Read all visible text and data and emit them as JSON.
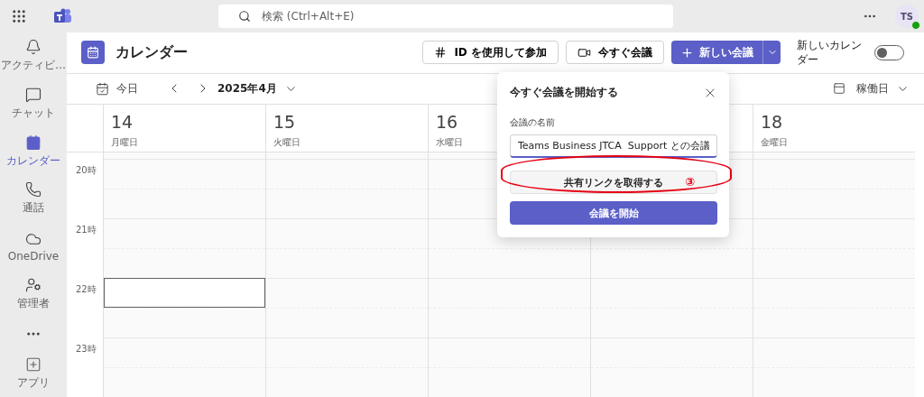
{
  "app_bar": {
    "search": {
      "placeholder": "検索 (Ctrl+Alt+E)"
    },
    "avatar": {
      "initials": "TS"
    }
  },
  "sidebar": {
    "items": [
      {
        "label": "アクティビ…",
        "selected": false
      },
      {
        "label": "チャット",
        "selected": false
      },
      {
        "label": "カレンダー",
        "selected": true
      },
      {
        "label": "通話",
        "selected": false
      },
      {
        "label": "OneDrive",
        "selected": false
      },
      {
        "label": "管理者",
        "selected": false
      }
    ],
    "apps": {
      "label": "アプリ"
    }
  },
  "header": {
    "title": "カレンダー",
    "join_button": "ID を使用して参加",
    "meet_now_button": "今すぐ会議",
    "new_meeting_button": "新しい会議",
    "new_calendar": {
      "label": "新しいカレンダー",
      "on": false
    }
  },
  "nav": {
    "today": "今日",
    "month": "2025年4月",
    "view": "稼働日"
  },
  "hours": [
    "20時",
    "21時",
    "22時",
    "23時"
  ],
  "days": [
    {
      "date": "14",
      "weekday": "月曜日",
      "slots": [
        {
          "selected": false
        },
        {
          "selected": false
        },
        {
          "selected": false
        },
        {
          "selected": false
        },
        {
          "selected": true
        },
        {
          "selected": false
        },
        {
          "selected": false
        },
        {
          "selected": false
        }
      ]
    },
    {
      "date": "15",
      "weekday": "火曜日",
      "slots": [
        {
          "selected": false
        },
        {
          "selected": false
        },
        {
          "selected": false
        },
        {
          "selected": false
        },
        {
          "selected": false
        },
        {
          "selected": false
        },
        {
          "selected": false
        },
        {
          "selected": false
        }
      ]
    },
    {
      "date": "16",
      "weekday": "水曜日",
      "slots": [
        {
          "selected": false
        },
        {
          "selected": false
        },
        {
          "selected": false
        },
        {
          "selected": false
        },
        {
          "selected": false
        },
        {
          "selected": false
        },
        {
          "selected": false
        },
        {
          "selected": false
        }
      ]
    },
    {
      "slots": [
        {
          "selected": false
        },
        {
          "selected": false
        },
        {
          "selected": false
        },
        {
          "selected": false
        },
        {
          "selected": false
        },
        {
          "selected": false
        },
        {
          "selected": false
        },
        {
          "selected": false
        }
      ]
    },
    {
      "date": "18",
      "weekday": "金曜日",
      "slots": [
        {
          "selected": false
        },
        {
          "selected": false
        },
        {
          "selected": false
        },
        {
          "selected": false
        },
        {
          "selected": false
        },
        {
          "selected": false
        },
        {
          "selected": false
        },
        {
          "selected": false
        }
      ]
    }
  ],
  "meet_now_popup": {
    "title": "今すぐ会議を開始する",
    "name_label": "会議の名前",
    "name_value": "Teams Business JTCA  Support との会議",
    "share_link_button": "共有リンクを取得する",
    "annotation": "③",
    "start_button": "会議を開始"
  }
}
